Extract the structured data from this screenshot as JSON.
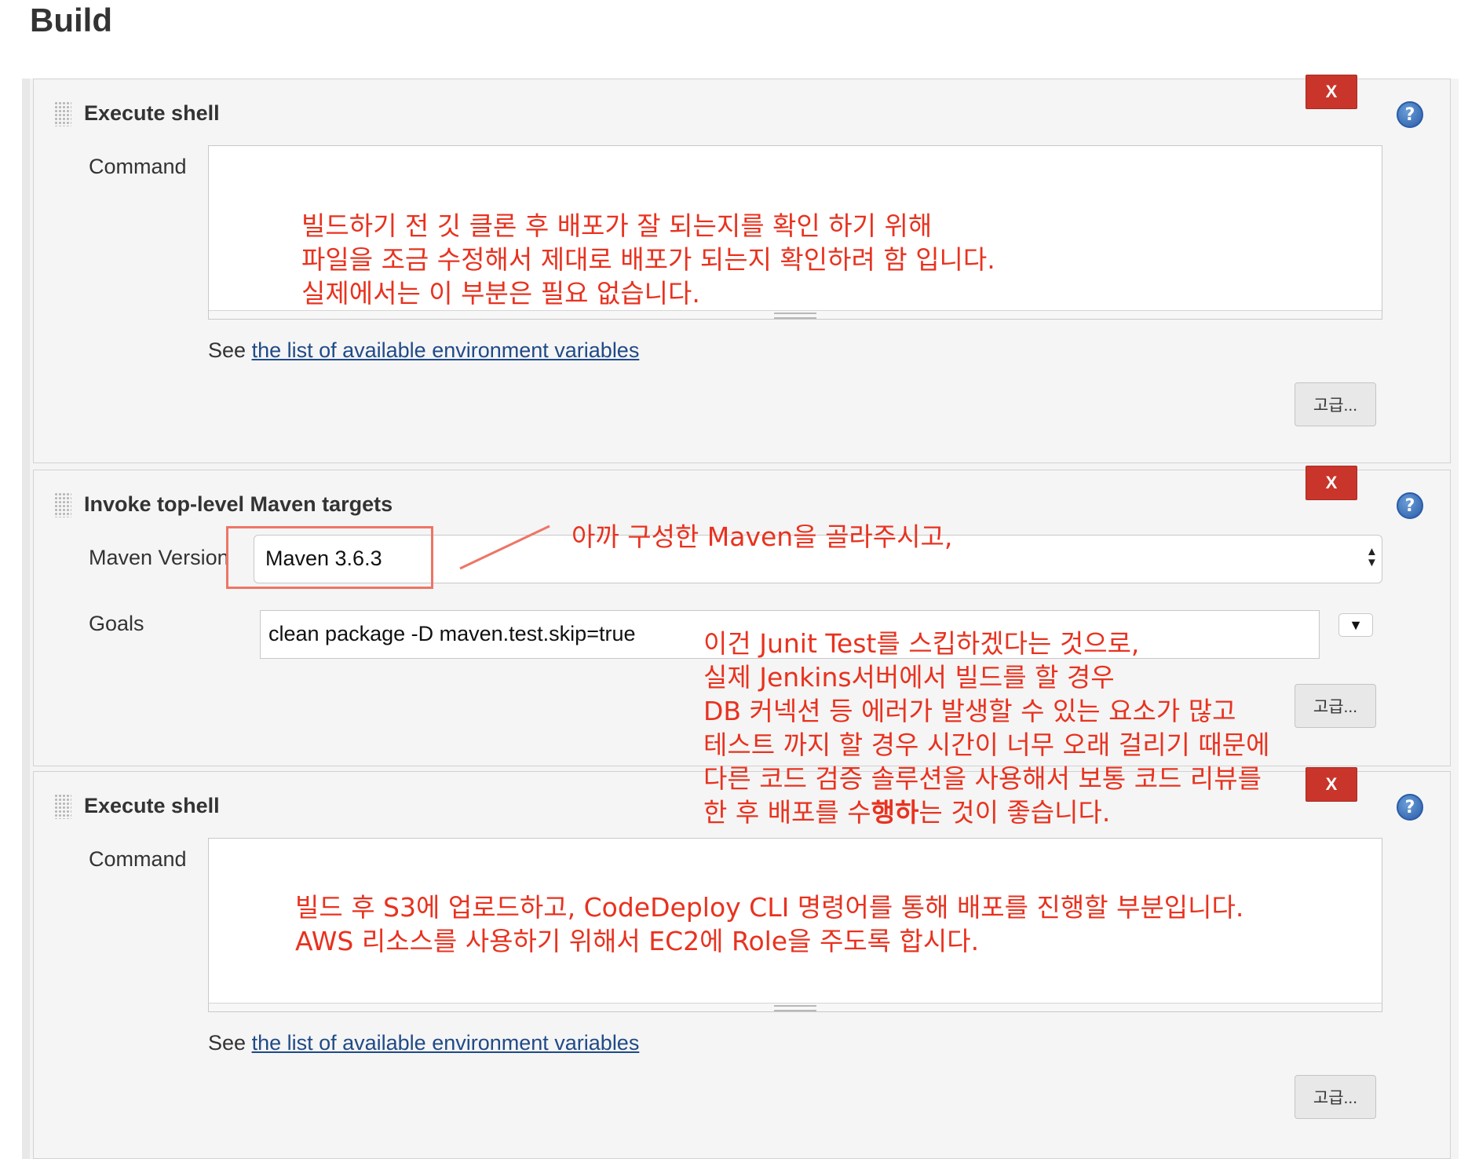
{
  "page": {
    "title": "Build"
  },
  "steps": [
    {
      "title": "Execute shell",
      "delete_label": "X",
      "help_label": "?",
      "command_label": "Command",
      "see_prefix": "See",
      "env_link": "the list of available environment variables",
      "advanced_label": "고급..."
    },
    {
      "title": "Invoke top-level Maven targets",
      "delete_label": "X",
      "help_label": "?",
      "maven_version_label": "Maven Version",
      "maven_version_value": "Maven 3.6.3",
      "goals_label": "Goals",
      "goals_value": "clean package -D maven.test.skip=true",
      "expand_icon": "▼",
      "advanced_label": "고급..."
    },
    {
      "title": "Execute shell",
      "delete_label": "X",
      "help_label": "?",
      "command_label": "Command",
      "see_prefix": "See",
      "env_link": "the list of available environment variables",
      "advanced_label": "고급..."
    }
  ],
  "annotations": {
    "note1": [
      "빌드하기 전 깃 클론 후 배포가 잘 되는지를 확인 하기 위해",
      "파일을 조금 수정해서 제대로 배포가 되는지 확인하려 함 입니다.",
      "실제에서는 이 부분은 필요 없습니다."
    ],
    "note2": "아까 구성한 Maven을 골라주시고,",
    "note3": [
      "이건 Junit Test를 스킵하겠다는 것으로,",
      "실제 Jenkins서버에서 빌드를 할 경우",
      "DB 커넥션 등 에러가 발생할 수 있는 요소가 많고",
      "테스트 까지 할 경우 시간이 너무 오래 걸리기 때문에",
      "다른 코드 검증 솔루션을 사용해서 보통 코드 리뷰를"
    ],
    "note3_last_a": "한 후 배포를 수",
    "note3_last_b": "행하",
    "note3_last_c": "는 것이 좋습니다.",
    "note4": [
      "빌드 후 S3에 업로드하고, CodeDeploy CLI 명령어를 통해 배포를 진행할 부분입니다.",
      "AWS 리소스를 사용하기 위해서 EC2에 Role을 주도록 합시다."
    ],
    "color": "#e8321f"
  },
  "colors": {
    "delete": "#c9352b",
    "link": "#204a87",
    "help": "#2a5ca8"
  }
}
